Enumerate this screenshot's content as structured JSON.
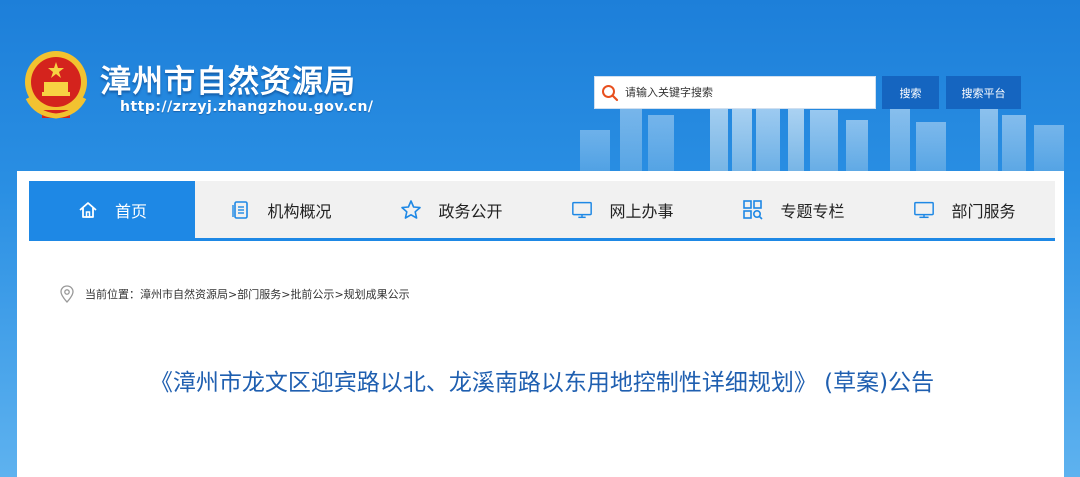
{
  "header": {
    "site_title": "漳州市自然资源局",
    "site_url": "http://zrzyj.zhangzhou.gov.cn/",
    "emblem_icon": "national-emblem-icon"
  },
  "search": {
    "placeholder": "请输入关键字搜索",
    "search_label": "搜索",
    "platform_label": "搜索平台"
  },
  "nav": {
    "items": [
      {
        "label": "首页",
        "icon": "home-icon"
      },
      {
        "label": "机构概况",
        "icon": "document-icon"
      },
      {
        "label": "政务公开",
        "icon": "star-icon"
      },
      {
        "label": "网上办事",
        "icon": "monitor-icon"
      },
      {
        "label": "专题专栏",
        "icon": "grid-search-icon"
      },
      {
        "label": "部门服务",
        "icon": "desktop-icon"
      }
    ]
  },
  "breadcrumb": {
    "prefix": "当前位置：",
    "path": [
      "漳州市自然资源局",
      "部门服务",
      "批前公示",
      "规划成果公示"
    ],
    "separator": ">"
  },
  "article": {
    "title": "《漳州市龙文区迎宾路以北、龙溪南路以东用地控制性详细规划》 (草案)公告"
  },
  "colors": {
    "header_blue": "#1d7fd9",
    "nav_active": "#1e88e5",
    "button_blue": "#1565c0",
    "title_blue": "#1f5fb0"
  }
}
